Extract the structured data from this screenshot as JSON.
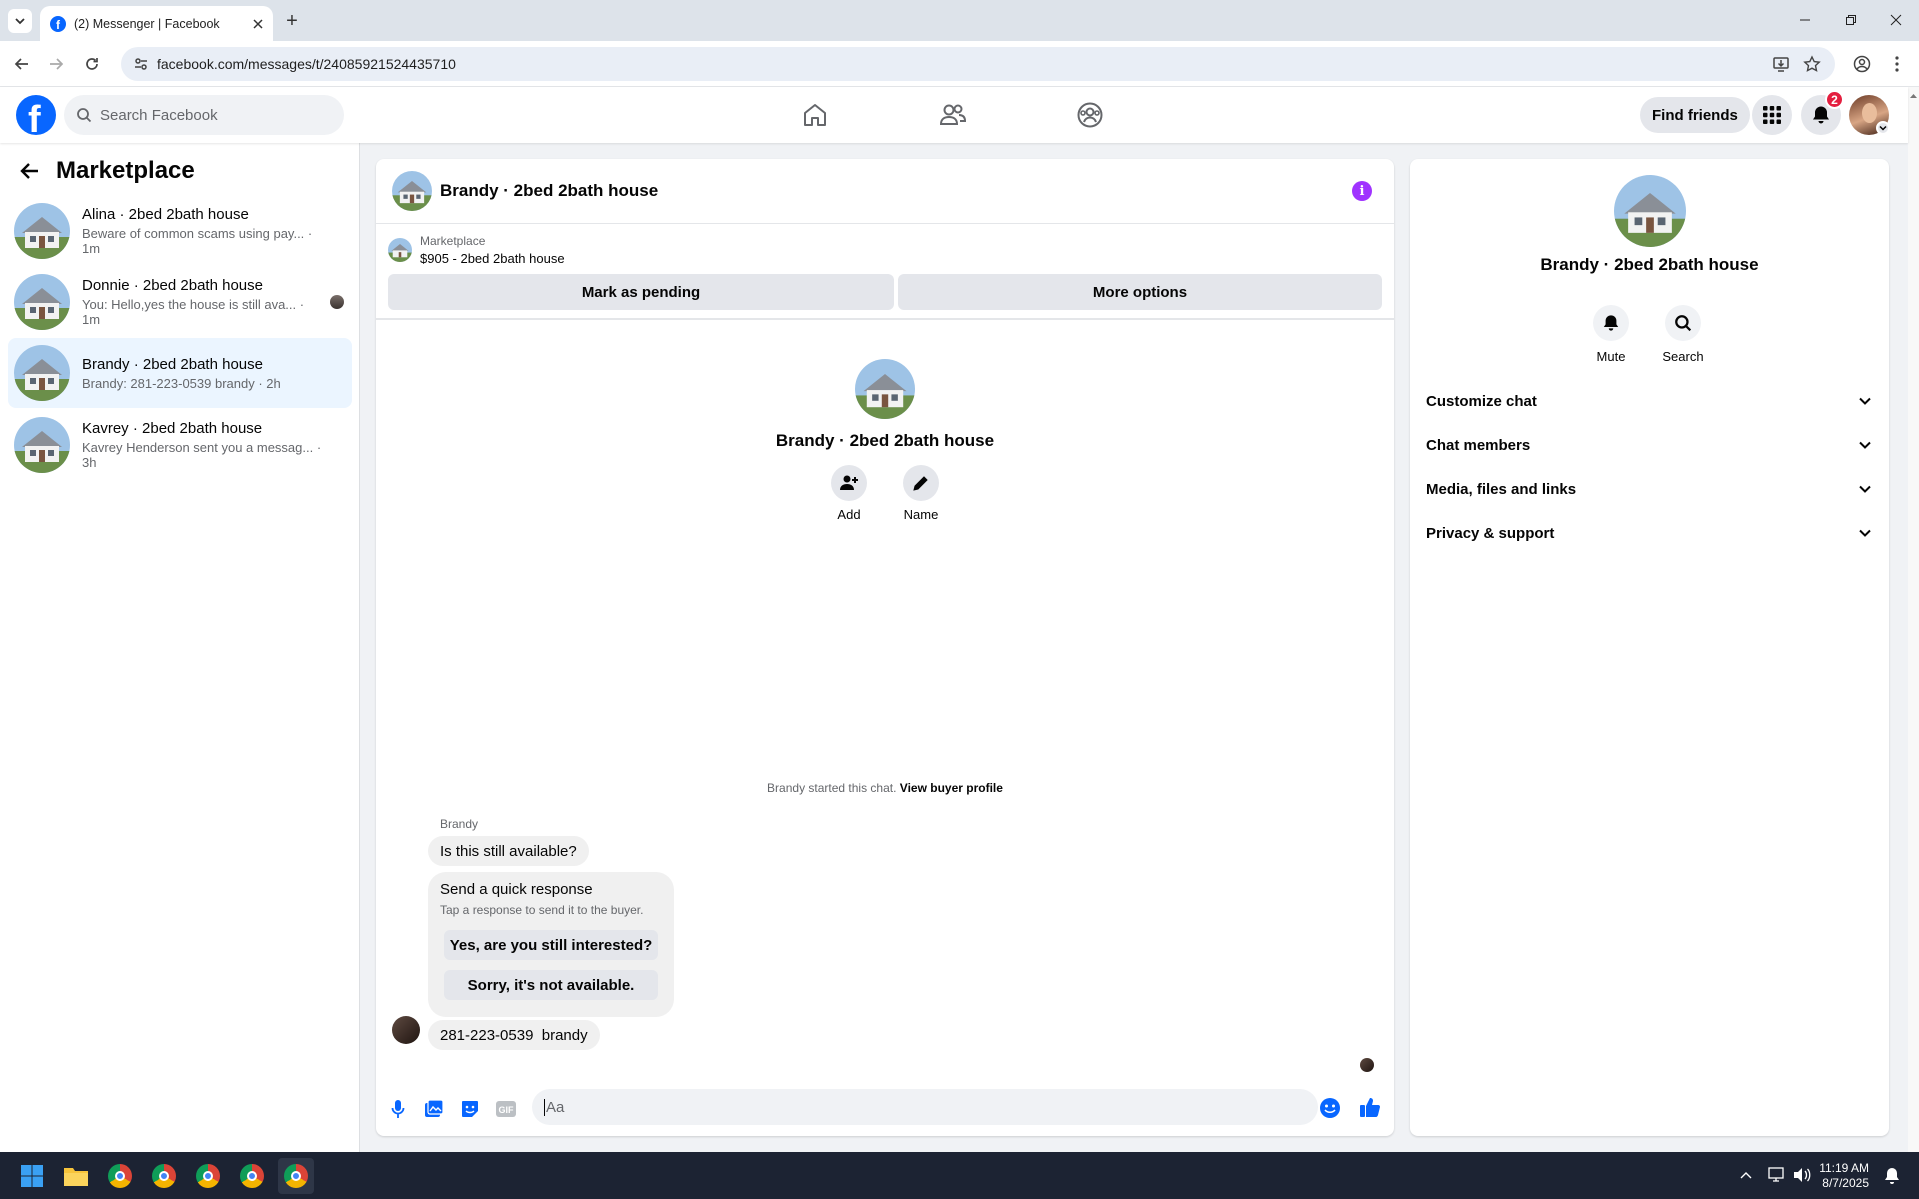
{
  "browser": {
    "tab_title": "(2) Messenger | Facebook",
    "url": "facebook.com/messages/t/24085921524435710"
  },
  "header": {
    "search_placeholder": "Search Facebook",
    "find_friends_label": "Find friends",
    "notifications_count": "2",
    "nav_icons": [
      "home-icon",
      "friends-icon",
      "groups-icon"
    ]
  },
  "sidebar": {
    "title": "Marketplace",
    "chats": [
      {
        "name": "Alina · 2bed 2bath house",
        "preview": "Beware of common scams using pay... · 1m"
      },
      {
        "name": "Donnie · 2bed 2bath house",
        "preview": "You: Hello,yes the house is still ava... · 1m"
      },
      {
        "name": "Brandy · 2bed 2bath house",
        "preview": "Brandy: 281-223-0539 brandy · 2h"
      },
      {
        "name": "Kavrey · 2bed 2bath house",
        "preview": "Kavrey Henderson sent you a messag... · 3h"
      }
    ]
  },
  "chat": {
    "title": "Brandy · 2bed 2bath house",
    "marketplace_label": "Marketplace",
    "listing": "$905 - 2bed 2bath house",
    "mark_pending_label": "Mark as pending",
    "more_options_label": "More options",
    "intro_title": "Brandy · 2bed 2bath house",
    "add_label": "Add",
    "name_label": "Name",
    "started_text": "Brandy started this chat.",
    "view_buyer_profile": "View buyer profile",
    "sender_name": "Brandy",
    "message_1": "Is this still available?",
    "quick_response_title": "Send a quick response",
    "quick_response_sub": "Tap a response to send it to the buyer.",
    "quick_reply_1": "Yes, are you still interested?",
    "quick_reply_2": "Sorry, it's not available.",
    "message_2": "281-223-0539  brandy",
    "input_placeholder": "Aa"
  },
  "details": {
    "title": "Brandy · 2bed 2bath house",
    "mute_label": "Mute",
    "search_label": "Search",
    "sections": [
      "Customize chat",
      "Chat members",
      "Media, files and links",
      "Privacy & support"
    ]
  },
  "taskbar": {
    "time": "11:19 AM",
    "date": "8/7/2025"
  },
  "colors": {
    "facebook_blue": "#0866ff",
    "active_chat_bg": "#ebf5ff",
    "info_purple": "#a033ff",
    "badge_red": "#e41e3f"
  }
}
